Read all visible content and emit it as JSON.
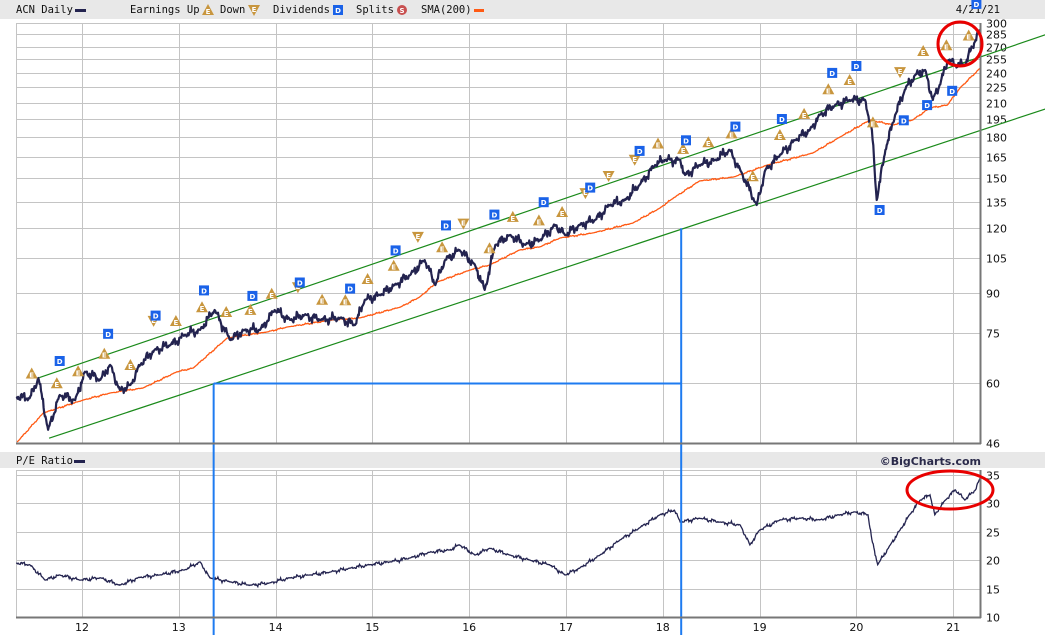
{
  "header": {
    "symbol_label": "ACN Daily",
    "earnings_label": "Earnings Up",
    "down_label": "Down",
    "dividends_label": "Dividends",
    "splits_label": "Splits",
    "sma_label": "SMA(200)",
    "date": "4/21/21"
  },
  "pe_panel": {
    "title": "P/E Ratio",
    "brand": "©BigCharts.com"
  },
  "colors": {
    "price": "#23234f",
    "sma": "#ff5a14",
    "channel": "#1a8a1a",
    "annotation": "#1e7bf0",
    "highlight": "#e80000",
    "earnings": "#c8963e",
    "dividend": "#1a62e8",
    "split": "#c85050",
    "grid": "#c4c4c4"
  },
  "chart_data": [
    {
      "type": "line",
      "title": "ACN Daily",
      "yscale": "log",
      "ylim": [
        46,
        300
      ],
      "xlim": [
        2011.32,
        2021.28
      ],
      "yticks": [
        300,
        285,
        270,
        255,
        240,
        225,
        210,
        195,
        180,
        165,
        150,
        135,
        120,
        105,
        90,
        75,
        60,
        46
      ],
      "xticks": [
        {
          "t": 2012,
          "label": "12"
        },
        {
          "t": 2013,
          "label": "13"
        },
        {
          "t": 2014,
          "label": "14"
        },
        {
          "t": 2015,
          "label": "15"
        },
        {
          "t": 2016,
          "label": "16"
        },
        {
          "t": 2017,
          "label": "17"
        },
        {
          "t": 2018,
          "label": "18"
        },
        {
          "t": 2019,
          "label": "19"
        },
        {
          "t": 2020,
          "label": "20"
        },
        {
          "t": 2021,
          "label": "21"
        }
      ],
      "grid": true,
      "series": [
        {
          "name": "ACN Daily",
          "points": [
            [
              2011.32,
              56.5
            ],
            [
              2011.46,
              56.2
            ],
            [
              2011.55,
              61.5
            ],
            [
              2011.65,
              48.8
            ],
            [
              2011.77,
              57.0
            ],
            [
              2011.93,
              55.7
            ],
            [
              2012.03,
              63.2
            ],
            [
              2012.19,
              61.0
            ],
            [
              2012.29,
              65.2
            ],
            [
              2012.39,
              58.3
            ],
            [
              2012.5,
              59.6
            ],
            [
              2012.6,
              65.2
            ],
            [
              2012.75,
              69.7
            ],
            [
              2012.91,
              71.2
            ],
            [
              2013.06,
              74.5
            ],
            [
              2013.22,
              76.2
            ],
            [
              2013.37,
              83.3
            ],
            [
              2013.53,
              72.9
            ],
            [
              2013.68,
              76.2
            ],
            [
              2013.84,
              76.2
            ],
            [
              2013.99,
              83.3
            ],
            [
              2014.15,
              79.7
            ],
            [
              2014.3,
              81.5
            ],
            [
              2014.46,
              79.7
            ],
            [
              2014.67,
              80.4
            ],
            [
              2014.82,
              77.9
            ],
            [
              2014.92,
              87.1
            ],
            [
              2015.08,
              89.1
            ],
            [
              2015.23,
              93.1
            ],
            [
              2015.39,
              97.4
            ],
            [
              2015.54,
              104.1
            ],
            [
              2015.65,
              93.1
            ],
            [
              2015.75,
              104.1
            ],
            [
              2015.9,
              108.9
            ],
            [
              2016.06,
              101.8
            ],
            [
              2016.16,
              91.1
            ],
            [
              2016.27,
              111.4
            ],
            [
              2016.42,
              116.4
            ],
            [
              2016.58,
              111.4
            ],
            [
              2016.73,
              113.8
            ],
            [
              2016.89,
              121.7
            ],
            [
              2016.99,
              116.4
            ],
            [
              2017.14,
              121.7
            ],
            [
              2017.3,
              124.5
            ],
            [
              2017.45,
              133.1
            ],
            [
              2017.61,
              136.1
            ],
            [
              2017.76,
              145.6
            ],
            [
              2017.92,
              159.1
            ],
            [
              2018.02,
              162.7
            ],
            [
              2018.18,
              162.7
            ],
            [
              2018.23,
              152.2
            ],
            [
              2018.38,
              159.1
            ],
            [
              2018.54,
              162.7
            ],
            [
              2018.69,
              170.2
            ],
            [
              2018.8,
              155.7
            ],
            [
              2018.97,
              133.1
            ],
            [
              2019.06,
              155.7
            ],
            [
              2019.21,
              166.4
            ],
            [
              2019.37,
              178.0
            ],
            [
              2019.52,
              186.0
            ],
            [
              2019.62,
              198.9
            ],
            [
              2019.78,
              208.0
            ],
            [
              2019.93,
              212.7
            ],
            [
              2020.09,
              212.7
            ],
            [
              2020.16,
              186.0
            ],
            [
              2020.21,
              136.1
            ],
            [
              2020.3,
              170.2
            ],
            [
              2020.4,
              198.9
            ],
            [
              2020.5,
              222.5
            ],
            [
              2020.61,
              237.9
            ],
            [
              2020.71,
              243.2
            ],
            [
              2020.79,
              212.7
            ],
            [
              2020.86,
              227.4
            ],
            [
              2020.95,
              254.3
            ],
            [
              2021.02,
              248.7
            ],
            [
              2021.12,
              248.7
            ],
            [
              2021.23,
              278.1
            ],
            [
              2021.28,
              290.7
            ]
          ]
        },
        {
          "name": "SMA(200)",
          "points": [
            [
              2011.33,
              46.2
            ],
            [
              2011.6,
              52.6
            ],
            [
              2012.01,
              55.7
            ],
            [
              2012.29,
              57.5
            ],
            [
              2012.63,
              58.8
            ],
            [
              2012.98,
              63.2
            ],
            [
              2013.15,
              64.3
            ],
            [
              2013.5,
              73.5
            ],
            [
              2013.91,
              75.5
            ],
            [
              2014.12,
              77.2
            ],
            [
              2014.59,
              79.7
            ],
            [
              2014.87,
              80.4
            ],
            [
              2015.29,
              84.4
            ],
            [
              2015.49,
              88.3
            ],
            [
              2015.67,
              94.4
            ],
            [
              2016.01,
              99.6
            ],
            [
              2016.21,
              101.8
            ],
            [
              2016.52,
              108.9
            ],
            [
              2016.73,
              110.4
            ],
            [
              2016.94,
              114.9
            ],
            [
              2017.28,
              117.5
            ],
            [
              2017.69,
              122.8
            ],
            [
              2017.97,
              131.3
            ],
            [
              2018.11,
              137.3
            ],
            [
              2018.38,
              148.2
            ],
            [
              2018.73,
              150.8
            ],
            [
              2019.08,
              159.1
            ],
            [
              2019.55,
              167.9
            ],
            [
              2019.83,
              180.3
            ],
            [
              2020.14,
              194.5
            ],
            [
              2020.38,
              190.3
            ],
            [
              2020.58,
              194.5
            ],
            [
              2020.76,
              205.3
            ],
            [
              2020.94,
              208.0
            ],
            [
              2021.07,
              224.4
            ],
            [
              2021.28,
              245.4
            ]
          ]
        }
      ],
      "trend_channel": {
        "upper": [
          [
            2011.56,
            61.6
          ],
          [
            2021.95,
            284.5
          ]
        ],
        "lower": [
          [
            2011.66,
            47.0
          ],
          [
            2021.95,
            204.3
          ]
        ]
      },
      "annotation_doubling": {
        "from": [
          2013.36,
          60
        ],
        "to": [
          2018.19,
          120
        ]
      },
      "events": {
        "earnings_up": [
          2011.48,
          2011.74,
          2011.96,
          2012.23,
          2012.5,
          2012.97,
          2013.24,
          2013.49,
          2013.74,
          2013.96,
          2014.48,
          2014.72,
          2014.95,
          2015.22,
          2015.72,
          2016.21,
          2016.45,
          2016.72,
          2016.96,
          2017.95,
          2018.21,
          2018.47,
          2018.71,
          2018.93,
          2019.21,
          2019.46,
          2019.71,
          2019.93,
          2020.17,
          2020.69,
          2020.93,
          2021.16
        ],
        "earnings_down": [
          2012.74,
          2014.23,
          2015.47,
          2015.94,
          2017.2,
          2017.44,
          2017.71,
          2020.45
        ],
        "dividends": [
          2011.77,
          2012.27,
          2012.76,
          2013.26,
          2013.76,
          2014.25,
          2014.77,
          2015.24,
          2015.76,
          2016.26,
          2016.77,
          2017.25,
          2017.76,
          2018.24,
          2018.75,
          2019.23,
          2019.75,
          2020.0,
          2020.24,
          2020.49,
          2020.73,
          2020.99,
          2021.24
        ]
      }
    },
    {
      "type": "line",
      "title": "P/E Ratio",
      "ylim": [
        10,
        35
      ],
      "yticks": [
        35,
        30,
        25,
        20,
        15,
        10
      ],
      "grid": true,
      "series": [
        {
          "name": "P/E Ratio",
          "points": [
            [
              2011.32,
              19.5
            ],
            [
              2011.46,
              19.2
            ],
            [
              2011.62,
              16.5
            ],
            [
              2011.77,
              17.4
            ],
            [
              2011.98,
              16.5
            ],
            [
              2012.19,
              16.9
            ],
            [
              2012.39,
              15.6
            ],
            [
              2012.6,
              17.0
            ],
            [
              2012.8,
              17.4
            ],
            [
              2013.06,
              18.3
            ],
            [
              2013.22,
              19.7
            ],
            [
              2013.32,
              16.9
            ],
            [
              2013.53,
              16.2
            ],
            [
              2013.74,
              15.6
            ],
            [
              2013.94,
              16.0
            ],
            [
              2014.15,
              16.9
            ],
            [
              2014.35,
              17.4
            ],
            [
              2014.56,
              17.9
            ],
            [
              2014.77,
              18.6
            ],
            [
              2014.97,
              19.2
            ],
            [
              2015.18,
              19.7
            ],
            [
              2015.39,
              20.4
            ],
            [
              2015.59,
              21.4
            ],
            [
              2015.8,
              21.8
            ],
            [
              2015.9,
              22.7
            ],
            [
              2016.06,
              20.9
            ],
            [
              2016.21,
              22.1
            ],
            [
              2016.42,
              20.9
            ],
            [
              2016.63,
              20.0
            ],
            [
              2016.83,
              19.2
            ],
            [
              2016.99,
              17.4
            ],
            [
              2017.14,
              18.6
            ],
            [
              2017.35,
              20.9
            ],
            [
              2017.56,
              23.6
            ],
            [
              2017.76,
              25.7
            ],
            [
              2017.97,
              28.0
            ],
            [
              2018.12,
              28.8
            ],
            [
              2018.18,
              26.7
            ],
            [
              2018.38,
              27.4
            ],
            [
              2018.59,
              26.7
            ],
            [
              2018.8,
              26.2
            ],
            [
              2018.9,
              22.7
            ],
            [
              2019.0,
              25.3
            ],
            [
              2019.21,
              27.1
            ],
            [
              2019.42,
              27.4
            ],
            [
              2019.62,
              27.1
            ],
            [
              2019.83,
              28.0
            ],
            [
              2019.98,
              28.5
            ],
            [
              2020.12,
              28.0
            ],
            [
              2020.16,
              23.6
            ],
            [
              2020.22,
              19.2
            ],
            [
              2020.35,
              22.7
            ],
            [
              2020.45,
              25.3
            ],
            [
              2020.55,
              28.0
            ],
            [
              2020.66,
              30.6
            ],
            [
              2020.76,
              31.5
            ],
            [
              2020.81,
              28.0
            ],
            [
              2020.92,
              30.6
            ],
            [
              2021.02,
              32.4
            ],
            [
              2021.12,
              30.6
            ],
            [
              2021.23,
              32.4
            ],
            [
              2021.28,
              34.5
            ]
          ]
        }
      ]
    }
  ]
}
